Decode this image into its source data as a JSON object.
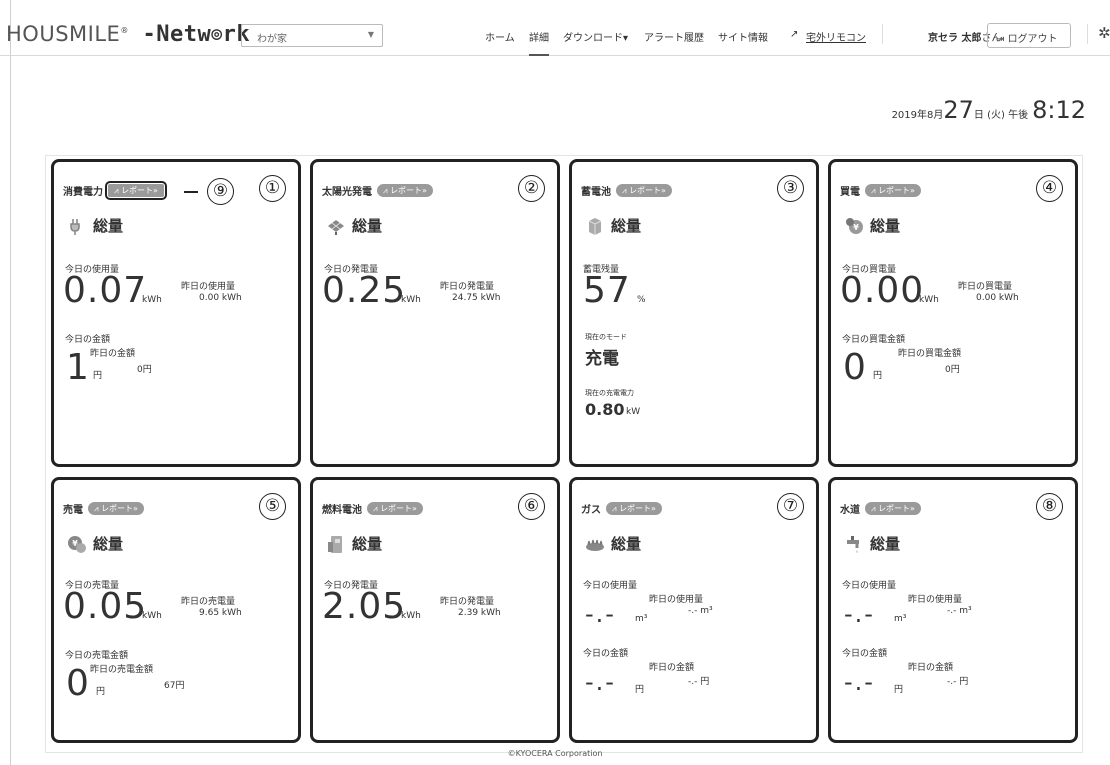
{
  "header": {
    "logo_light": "HOUSMILE",
    "logo_mark": "®",
    "logo_bold": " -Netw",
    "logo_bold2": "rk",
    "home_select": "わが家",
    "nav": {
      "home": "ホーム",
      "detail": "詳細",
      "download": "ダウンロード▾",
      "alert": "アラート履歴",
      "site": "サイト情報",
      "remote": "宅外リモコン"
    },
    "user_name": "京セラ 太郎",
    "user_suffix": "さん",
    "logout": "ログアウト"
  },
  "datetime": {
    "prefix": "2019年8月",
    "day": "27",
    "suffix": "日 (火)  午後",
    "time": "8:12"
  },
  "badge_label": "レポート»",
  "cards": {
    "c1": {
      "title": "消費電力",
      "num": "①",
      "subtitle": "総量",
      "today_label": "今日の使用量",
      "today_value": "0.07",
      "today_unit": "kWh",
      "yday_label": "昨日の使用量",
      "yday_value": "0.00 kWh",
      "money_label": "今日の金額",
      "money_value": "1",
      "money_unit": "円",
      "ymoney_label": "昨日の金額",
      "ymoney_value": "0円",
      "callout": "⑨"
    },
    "c2": {
      "title": "太陽光発電",
      "num": "②",
      "subtitle": "総量",
      "today_label": "今日の発電量",
      "today_value": "0.25",
      "today_unit": "kWh",
      "yday_label": "昨日の発電量",
      "yday_value": "24.75 kWh"
    },
    "c3": {
      "title": "蓄電池",
      "num": "③",
      "subtitle": "総量",
      "remain_label": "蓄電残量",
      "remain_value": "57",
      "remain_unit": "%",
      "mode_label": "現在のモード",
      "mode_value": "充電",
      "power_label": "現在の充電電力",
      "power_value": "0.80",
      "power_unit": "kW"
    },
    "c4": {
      "title": "買電",
      "num": "④",
      "subtitle": "総量",
      "today_label": "今日の買電量",
      "today_value": "0.00",
      "today_unit": "kWh",
      "yday_label": "昨日の買電量",
      "yday_value": "0.00 kWh",
      "money_label": "今日の買電金額",
      "money_value": "0",
      "money_unit": "円",
      "ymoney_label": "昨日の買電金額",
      "ymoney_value": "0円"
    },
    "c5": {
      "title": "売電",
      "num": "⑤",
      "subtitle": "総量",
      "today_label": "今日の売電量",
      "today_value": "0.05",
      "today_unit": "kWh",
      "yday_label": "昨日の売電量",
      "yday_value": "9.65 kWh",
      "money_label": "今日の売電金額",
      "money_value": "0",
      "money_unit": "円",
      "ymoney_label": "昨日の売電金額",
      "ymoney_value": "67円"
    },
    "c6": {
      "title": "燃料電池",
      "num": "⑥",
      "subtitle": "総量",
      "today_label": "今日の発電量",
      "today_value": "2.05",
      "today_unit": "kWh",
      "yday_label": "昨日の発電量",
      "yday_value": "2.39 kWh"
    },
    "c7": {
      "title": "ガス",
      "num": "⑦",
      "subtitle": "総量",
      "today_label": "今日の使用量",
      "today_value": "-.-",
      "today_unit": "m³",
      "yday_label": "昨日の使用量",
      "yday_value": "-.- m³",
      "money_label": "今日の金額",
      "money_value": "-.-",
      "money_unit": "円",
      "ymoney_label": "昨日の金額",
      "ymoney_value": "-.- 円"
    },
    "c8": {
      "title": "水道",
      "num": "⑧",
      "subtitle": "総量",
      "today_label": "今日の使用量",
      "today_value": "-.-",
      "today_unit": "m³",
      "yday_label": "昨日の使用量",
      "yday_value": "-.- m³",
      "money_label": "今日の金額",
      "money_value": "-.-",
      "money_unit": "円",
      "ymoney_label": "昨日の金額",
      "ymoney_value": "-.- 円"
    }
  },
  "footer": "©KYOCERA Corporation"
}
